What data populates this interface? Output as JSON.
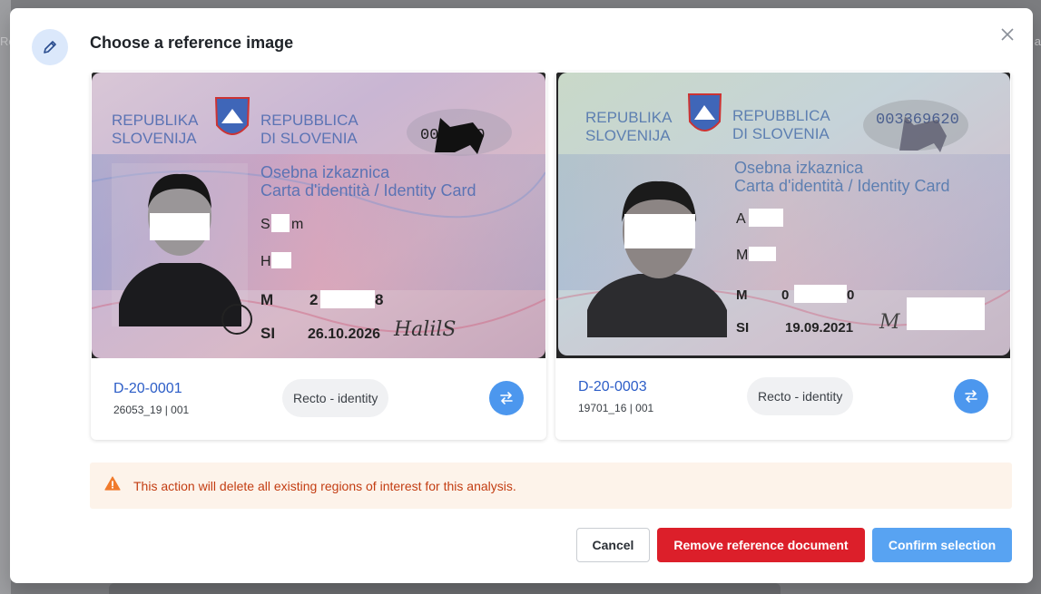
{
  "backdrop": {
    "left_fragment": "Re",
    "right_fragment": "a"
  },
  "modal": {
    "title": "Choose a reference image",
    "header_icon": "pencil-icon",
    "close_icon": "close-icon"
  },
  "cards": [
    {
      "doc_id": "D-20-0001",
      "doc_sub": "26053_19 | 001",
      "chip_label": "Recto - identity",
      "swap_icon": "swap-arrows-icon",
      "id_card": {
        "country_si": "REPUBLIKA\nSLOVENIJA",
        "country_it": "REPUBBLICA\nDI SLOVENIA",
        "title_si": "Osebna izkaznica",
        "title_it": "Carta d'identità / Identity Card",
        "number_visible": "00 1020",
        "surname_visible": "S m",
        "name_visible": "H",
        "sex": "M",
        "dob_visible": "2 8",
        "nationality": "SI",
        "expiry": "26.10.2026",
        "signature": "HalilS"
      }
    },
    {
      "doc_id": "D-20-0003",
      "doc_sub": "19701_16 | 001",
      "chip_label": "Recto - identity",
      "swap_icon": "swap-arrows-icon",
      "id_card": {
        "country_si": "REPUBLIKA\nSLOVENIJA",
        "country_it": "REPUBBLICA\nDI SLOVENIA",
        "title_si": "Osebna izkaznica",
        "title_it": "Carta d'identità / Identity Card",
        "number_visible": "003369620",
        "surname_visible": "A",
        "name_visible": "M",
        "sex": "M",
        "dob_visible": "0 0",
        "nationality": "SI",
        "expiry": "19.09.2021",
        "signature": "M"
      }
    }
  ],
  "warning": {
    "icon": "warning-triangle-icon",
    "text": "This action will delete all existing regions of interest for this analysis."
  },
  "actions": {
    "cancel": "Cancel",
    "remove": "Remove reference document",
    "confirm": "Confirm selection"
  },
  "colors": {
    "accent": "#4c97ee",
    "danger": "#dc1f2a",
    "warning_bg": "#fdf3ea",
    "warning_text": "#c33d12",
    "link": "#2c5dc7"
  }
}
